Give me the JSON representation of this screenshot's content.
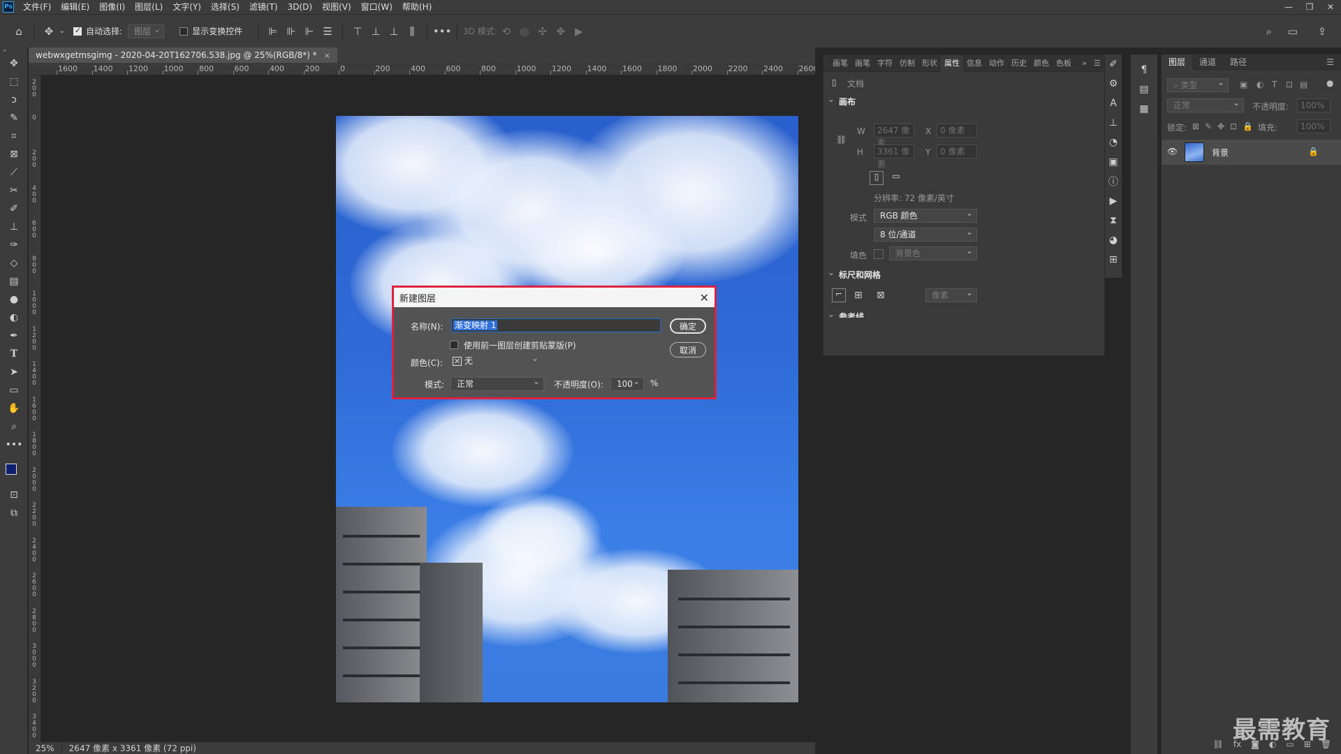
{
  "menubar": {
    "logo": "Ps",
    "items": [
      "文件(F)",
      "编辑(E)",
      "图像(I)",
      "图层(L)",
      "文字(Y)",
      "选择(S)",
      "滤镜(T)",
      "3D(D)",
      "视图(V)",
      "窗口(W)",
      "帮助(H)"
    ]
  },
  "window_controls": {
    "minimize": "—",
    "restore": "❐",
    "close": "✕"
  },
  "options": {
    "auto_select_label": "自动选择:",
    "auto_select_target": "图层",
    "show_transform_label": "显示变换控件",
    "more": "•••",
    "mode_3d_label": "3D 模式:"
  },
  "document": {
    "tab_title": "webwxgetmsgimg - 2020-04-20T162706.538.jpg @ 25%(RGB/8*) *",
    "tab_close": "×"
  },
  "ruler": {
    "h_labels": [
      "1600",
      "1400",
      "1200",
      "1000",
      "800",
      "600",
      "400",
      "200",
      "0",
      "200",
      "400",
      "600",
      "800",
      "1000",
      "1200",
      "1400",
      "1600",
      "1800",
      "2000",
      "2200",
      "2400",
      "2600"
    ],
    "v_labels": [
      "2 0 0",
      "0",
      "2 0 0",
      "4 0 0",
      "6 0 0",
      "8 0 0",
      "1 0 0 0",
      "1 2 0 0",
      "1 4 0 0",
      "1 6 0 0",
      "1 8 0 0",
      "2 0 0 0",
      "2 2 0 0",
      "2 4 0 0",
      "2 6 0 0",
      "2 8 0 0",
      "3 0 0 0",
      "3 2 0 0",
      "3 4 0 0"
    ]
  },
  "status": {
    "zoom": "25%",
    "doc_info": "2647 像素 x 3361 像素 (72 ppi)"
  },
  "dialog": {
    "title": "新建图层",
    "close": "✕",
    "name_label": "名称(N):",
    "name_value": "渐变映射 1",
    "clip_label": "使用前一图层创建剪贴蒙版(P)",
    "color_label": "颜色(C):",
    "color_value": "无",
    "mode_label": "模式:",
    "mode_value": "正常",
    "opacity_label": "不透明度(O):",
    "opacity_value": "100",
    "opacity_unit": "%",
    "ok": "确定",
    "cancel": "取消"
  },
  "properties": {
    "tabs": [
      "画笔",
      "画笔",
      "字符",
      "仿制",
      "形状",
      "属性",
      "信息",
      "动作",
      "历史",
      "颜色",
      "色板"
    ],
    "active_tab": "属性",
    "section_doc": "文档",
    "section_canvas": "画布",
    "w_label": "W",
    "w_value": "2647 像素",
    "h_label": "H",
    "h_value": "3361 像素",
    "x_label": "X",
    "x_value": "0 像素",
    "y_label": "Y",
    "y_value": "0 像素",
    "resolution": "分辨率: 72 像素/英寸",
    "mode_label": "模式",
    "mode_value": "RGB 颜色",
    "depth_value": "8 位/通道",
    "fill_label": "填色",
    "fill_value": "背景色",
    "section_rulers": "标尺和网格",
    "unit_value": "像素",
    "section_guides": "参考线"
  },
  "layers": {
    "tabs": [
      "图层",
      "通道",
      "路径"
    ],
    "filter_placeholder": "类型",
    "blend_mode": "正常",
    "opacity_label": "不透明度:",
    "opacity_value": "100%",
    "lock_label": "锁定:",
    "fill_label": "填充:",
    "fill_value": "100%",
    "layer_name": "背景"
  },
  "watermark": "最需教育"
}
